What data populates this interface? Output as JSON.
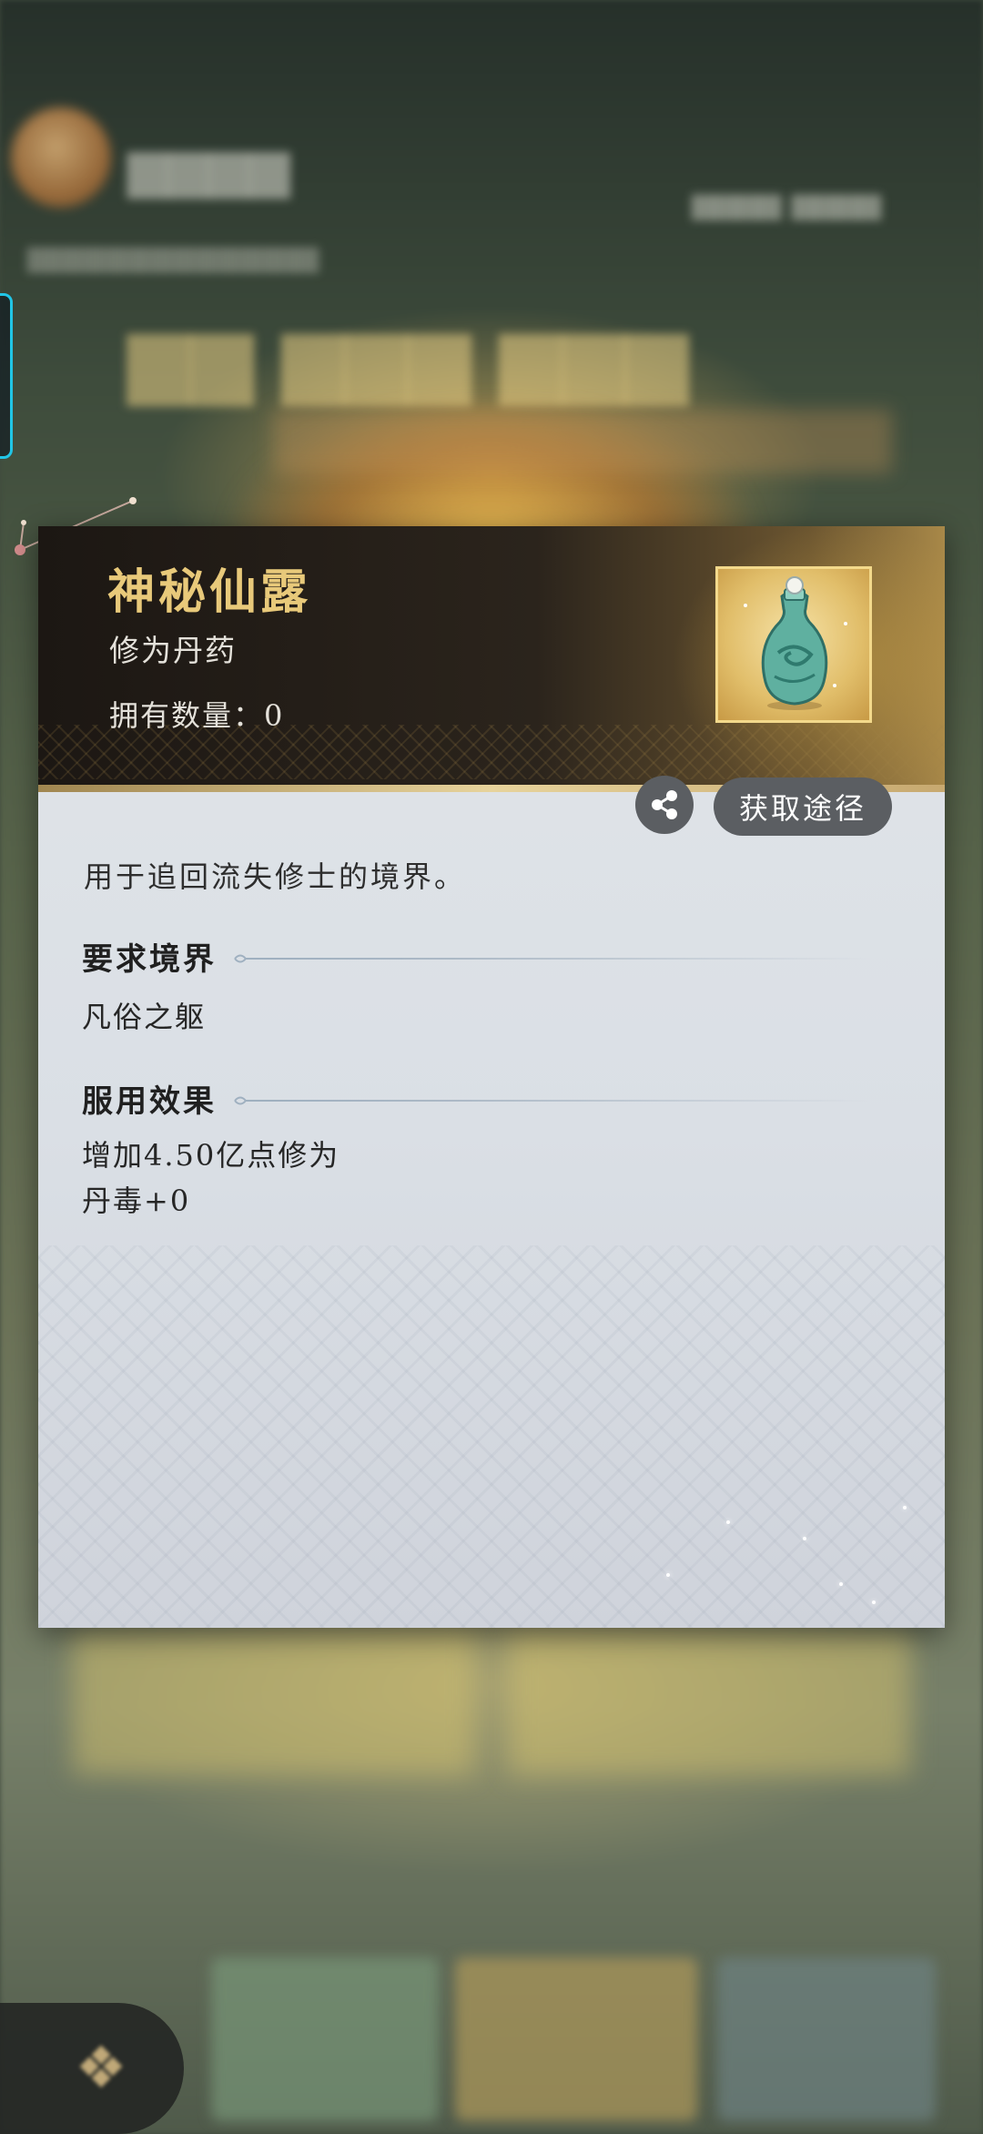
{
  "item": {
    "name": "神秘仙露",
    "type": "修为丹药",
    "owned_label": "拥有数量：",
    "owned_count": "0",
    "description": "用于追回流失修士的境界。",
    "icon": "jade-bottle-icon"
  },
  "actions": {
    "share_icon": "share-icon",
    "source_label": "获取途径"
  },
  "sections": {
    "requirement": {
      "title": "要求境界",
      "value": "凡俗之躯"
    },
    "effect": {
      "title": "服用效果",
      "lines": [
        "增加4.50亿点修为",
        "丹毒+0"
      ]
    }
  },
  "colors": {
    "title_gold": "#e8c97a",
    "button_gray": "#5b5e62",
    "panel_bg": "#e1e5e9",
    "edge_tab_cyan": "#21c5e6"
  }
}
